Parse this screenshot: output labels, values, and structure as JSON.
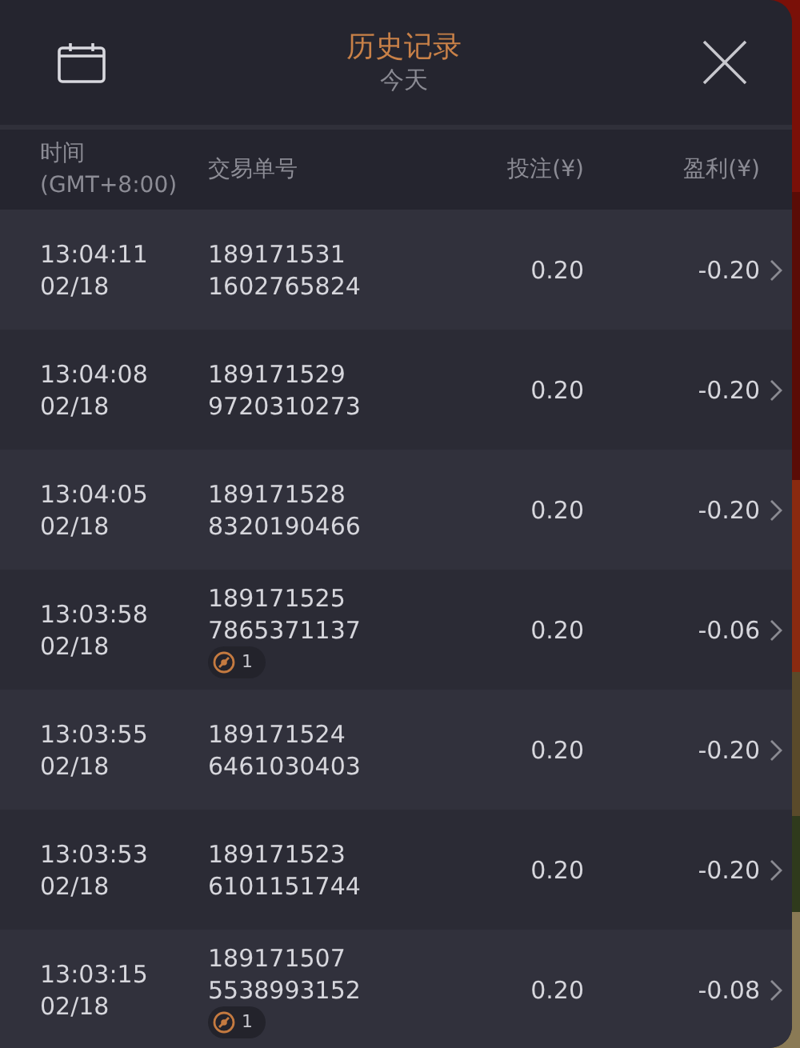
{
  "header": {
    "title": "历史记录",
    "subtitle": "今天"
  },
  "columns": [
    {
      "label": "时间",
      "sublabel": "(GMT+8:00)"
    },
    {
      "label": "交易单号"
    },
    {
      "label": "投注(¥)"
    },
    {
      "label": "盈利(¥)"
    }
  ],
  "rows": [
    {
      "time": "13:04:11",
      "date": "02/18",
      "order_1": "189171531",
      "order_2": "1602765824",
      "stake": "0.20",
      "profit": "-0.20"
    },
    {
      "time": "13:04:08",
      "date": "02/18",
      "order_1": "189171529",
      "order_2": "9720310273",
      "stake": "0.20",
      "profit": "-0.20"
    },
    {
      "time": "13:04:05",
      "date": "02/18",
      "order_1": "189171528",
      "order_2": "8320190466",
      "stake": "0.20",
      "profit": "-0.20"
    },
    {
      "time": "13:03:58",
      "date": "02/18",
      "order_1": "189171525",
      "order_2": "7865371137",
      "badge": "1",
      "stake": "0.20",
      "profit": "-0.06"
    },
    {
      "time": "13:03:55",
      "date": "02/18",
      "order_1": "189171524",
      "order_2": "6461030403",
      "stake": "0.20",
      "profit": "-0.20"
    },
    {
      "time": "13:03:53",
      "date": "02/18",
      "order_1": "189171523",
      "order_2": "6101151744",
      "stake": "0.20",
      "profit": "-0.20"
    },
    {
      "time": "13:03:15",
      "date": "02/18",
      "order_1": "189171507",
      "order_2": "5538993152",
      "badge": "1",
      "stake": "0.20",
      "profit": "-0.08"
    }
  ]
}
